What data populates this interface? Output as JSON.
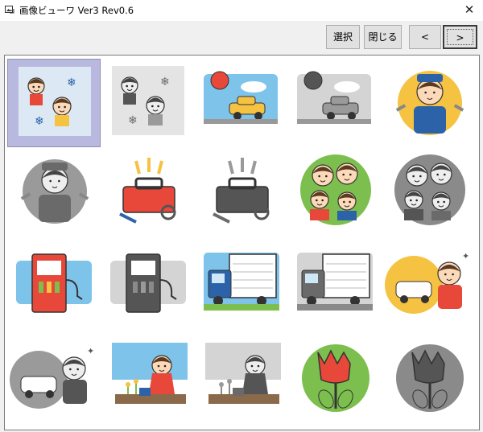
{
  "window": {
    "title": "画像ビューワ Ver3 Rev0.6",
    "close_glyph": "✕"
  },
  "toolbar": {
    "select_label": "選択",
    "close_label": "閉じる",
    "prev_label": "<",
    "next_label": ">"
  },
  "thumbnails": [
    {
      "name": "thumb-kids-snow",
      "palette": "color",
      "selected": true
    },
    {
      "name": "thumb-kids-snow-gray",
      "palette": "gray",
      "selected": false
    },
    {
      "name": "thumb-car-sun",
      "palette": "color",
      "selected": false
    },
    {
      "name": "thumb-car-sun-gray",
      "palette": "gray",
      "selected": false
    },
    {
      "name": "thumb-mechanic",
      "palette": "color",
      "selected": false
    },
    {
      "name": "thumb-mechanic-gray",
      "palette": "gray",
      "selected": false
    },
    {
      "name": "thumb-toolbox",
      "palette": "color",
      "selected": false
    },
    {
      "name": "thumb-toolbox-gray",
      "palette": "gray",
      "selected": false
    },
    {
      "name": "thumb-family",
      "palette": "color",
      "selected": false
    },
    {
      "name": "thumb-family-gray",
      "palette": "gray",
      "selected": false
    },
    {
      "name": "thumb-fuel-pump",
      "palette": "color",
      "selected": false
    },
    {
      "name": "thumb-fuel-pump-gray",
      "palette": "gray",
      "selected": false
    },
    {
      "name": "thumb-truck",
      "palette": "color",
      "selected": false
    },
    {
      "name": "thumb-truck-gray",
      "palette": "gray",
      "selected": false
    },
    {
      "name": "thumb-boy-car",
      "palette": "color",
      "selected": false
    },
    {
      "name": "thumb-boy-car-gray",
      "palette": "gray",
      "selected": false
    },
    {
      "name": "thumb-girl-watering",
      "palette": "color",
      "selected": false
    },
    {
      "name": "thumb-girl-watering-gray",
      "palette": "gray",
      "selected": false
    },
    {
      "name": "thumb-tulip",
      "palette": "color",
      "selected": false
    },
    {
      "name": "thumb-tulip-gray",
      "palette": "gray",
      "selected": false
    }
  ]
}
